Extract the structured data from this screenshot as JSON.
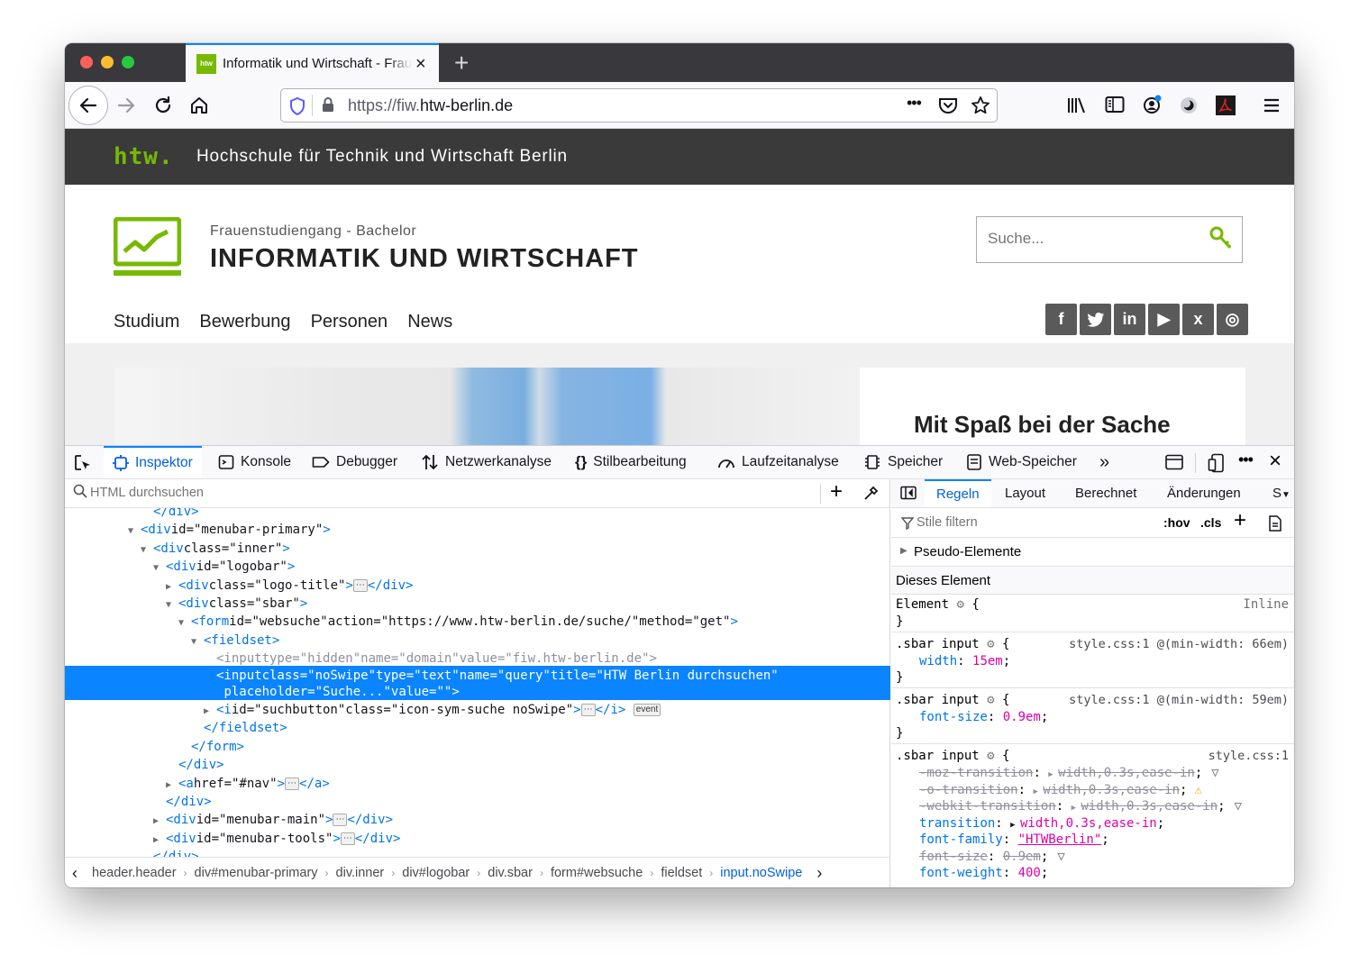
{
  "browser": {
    "tab_title": "Informatik und Wirtschaft - Frauenstudiengang",
    "tab_favicon_text": "htw",
    "url_host_prefix": "https://fiw.",
    "url_host_main": "htw-berlin.de",
    "url_more": "•••"
  },
  "site": {
    "htw_logo": "htw.",
    "institution": "Hochschule für Technik und Wirtschaft Berlin",
    "subtitle": "Frauenstudiengang - Bachelor",
    "title": "INFORMATIK UND WIRTSCHAFT",
    "search_placeholder": "Suche...",
    "nav": [
      "Studium",
      "Bewerbung",
      "Personen",
      "News"
    ],
    "social": [
      "f",
      "t",
      "in",
      "▶",
      "x",
      "◎"
    ],
    "hero_title": "Mit Spaß bei der Sache",
    "brand_color": "#76b900"
  },
  "devtools": {
    "tabs": [
      "Inspektor",
      "Konsole",
      "Debugger",
      "Netzwerkanalyse",
      "Stilbearbeitung",
      "Laufzeitanalyse",
      "Speicher",
      "Web-Speicher"
    ],
    "html_search_placeholder": "HTML durchsuchen",
    "breadcrumbs": [
      "header.header",
      "div#menubar-primary",
      "div.inner",
      "div#logobar",
      "div.sbar",
      "form#websuche",
      "fieldset",
      "input.noSwipe"
    ],
    "rules_tabs": [
      "Regeln",
      "Layout",
      "Berechnet",
      "Änderungen",
      "S"
    ],
    "filter_placeholder": "Stile filtern",
    "hov": ":hov",
    "cls": ".cls",
    "pseudo": "Pseudo-Elemente",
    "this_element": "Dieses Element",
    "element_rule": "Element",
    "inline": "Inline",
    "rule1_selector": ".sbar input",
    "rule1_source": "style.css:1 @(min-width: 66em)",
    "rule1_prop": "width",
    "rule1_val": "15em",
    "rule2_selector": ".sbar input",
    "rule2_source": "style.css:1 @(min-width: 59em)",
    "rule2_prop": "font-size",
    "rule2_val": "0.9em",
    "rule3_selector": ".sbar input",
    "rule3_source": "style.css:1",
    "rule3_decls": [
      {
        "p": "-moz-transition",
        "v": "width,0.3s,ease-in",
        "strike": true
      },
      {
        "p": "-o-transition",
        "v": "width,0.3s,ease-in",
        "strike": true
      },
      {
        "p": "-webkit-transition",
        "v": "width,0.3s,ease-in",
        "strike": true
      },
      {
        "p": "transition",
        "v": "width,0.3s,ease-in",
        "strike": false
      },
      {
        "p": "font-family",
        "v": "\"HTWBerlin\"",
        "strike": false
      },
      {
        "p": "font-size",
        "v": "0.9em",
        "strike": true
      },
      {
        "p": "font-weight",
        "v": "400",
        "strike": false
      }
    ],
    "markup_lines": [
      {
        "indent": 6,
        "dim": false,
        "html": "</div>"
      },
      {
        "indent": 5,
        "tw": "open",
        "html": "<div id=\"menubar-primary\">"
      },
      {
        "indent": 6,
        "tw": "open",
        "html": "<div class=\"inner\">"
      },
      {
        "indent": 7,
        "tw": "open",
        "html": "<div id=\"logobar\">"
      },
      {
        "indent": 8,
        "tw": "closed",
        "html": "<div class=\"logo-title\">⋯</div>"
      },
      {
        "indent": 8,
        "tw": "open",
        "html": "<div class=\"sbar\">"
      },
      {
        "indent": 9,
        "tw": "open",
        "html": "<form id=\"websuche\" action=\"https://www.htw-berlin.de/suche/\" method=\"get\">"
      },
      {
        "indent": 10,
        "tw": "open",
        "html": "<fieldset>"
      },
      {
        "indent": 11,
        "dim": true,
        "html": "<input type=\"hidden\" name=\"domain\" value=\"fiw.htw-berlin.de\">"
      },
      {
        "indent": 11,
        "sel": true,
        "html": "<input class=\"noSwipe\" type=\"text\" name=\"query\" title=\"HTW Berlin durchsuchen\""
      },
      {
        "indent": 11,
        "sel": true,
        "html": "placeholder=\"Suche...\" value=\"\">"
      },
      {
        "indent": 11,
        "tw": "closed",
        "html": "<i id=\"suchbutton\" class=\"icon-sym-suche noSwipe\">⋯</i>",
        "badge": "event"
      },
      {
        "indent": 10,
        "html": "</fieldset>"
      },
      {
        "indent": 9,
        "html": "</form>"
      },
      {
        "indent": 8,
        "html": "</div>"
      },
      {
        "indent": 8,
        "tw": "closed",
        "html": "<a href=\"#nav\">⋯</a>"
      },
      {
        "indent": 7,
        "html": "</div>"
      },
      {
        "indent": 7,
        "tw": "closed",
        "html": "<div id=\"menubar-main\">⋯</div>"
      },
      {
        "indent": 7,
        "tw": "closed",
        "html": "<div id=\"menubar-tools\">⋯</div>"
      },
      {
        "indent": 6,
        "html": "</div>"
      }
    ]
  }
}
